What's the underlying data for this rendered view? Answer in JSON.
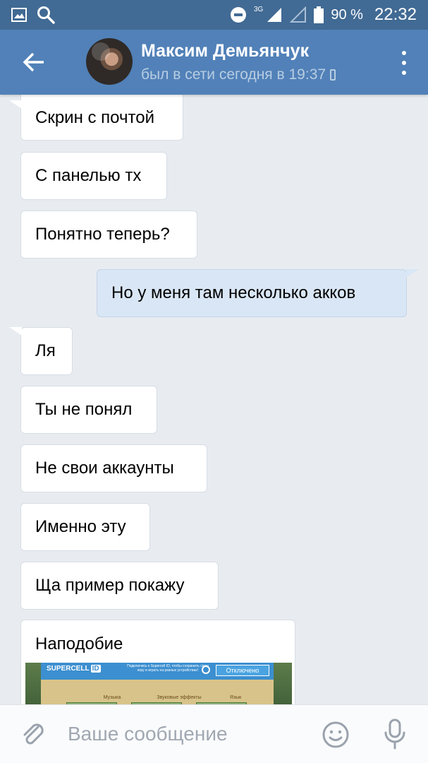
{
  "status_bar": {
    "network": "3G",
    "battery": "90 %",
    "time": "22:32"
  },
  "header": {
    "contact_name": "Максим Демьянчук",
    "last_seen": "был в сети сегодня в 19:37"
  },
  "messages": [
    {
      "direction": "in",
      "text": "Скрин с почтой"
    },
    {
      "direction": "in",
      "text": "С панелью тх"
    },
    {
      "direction": "in",
      "text": "Понятно теперь?"
    },
    {
      "direction": "out",
      "text": "Но у меня там несколько акков"
    },
    {
      "direction": "in",
      "text": "Ля"
    },
    {
      "direction": "in",
      "text": "Ты не понял"
    },
    {
      "direction": "in",
      "text": "Не свои аккаунты"
    },
    {
      "direction": "in",
      "text": "Именно эту"
    },
    {
      "direction": "in",
      "text": "Ща пример покажу"
    },
    {
      "direction": "in",
      "text": "Наподобие"
    }
  ],
  "attachment_preview": {
    "logo": "SUPERCELL",
    "id_badge": "ID",
    "caption": "Подключись к Supercell ID, чтобы сохранить свою игру и играть на разных устройствах!",
    "button": "Отключено",
    "options": [
      "Музыка",
      "Звуковые эффекты",
      "Язык"
    ]
  },
  "composer": {
    "placeholder": "Ваше сообщение"
  },
  "colors": {
    "status_bar": "#416a94",
    "app_bar": "#5181b8",
    "chat_background": "#e8ecf1",
    "incoming_bubble": "#ffffff",
    "outgoing_bubble": "#d9e6f5"
  }
}
